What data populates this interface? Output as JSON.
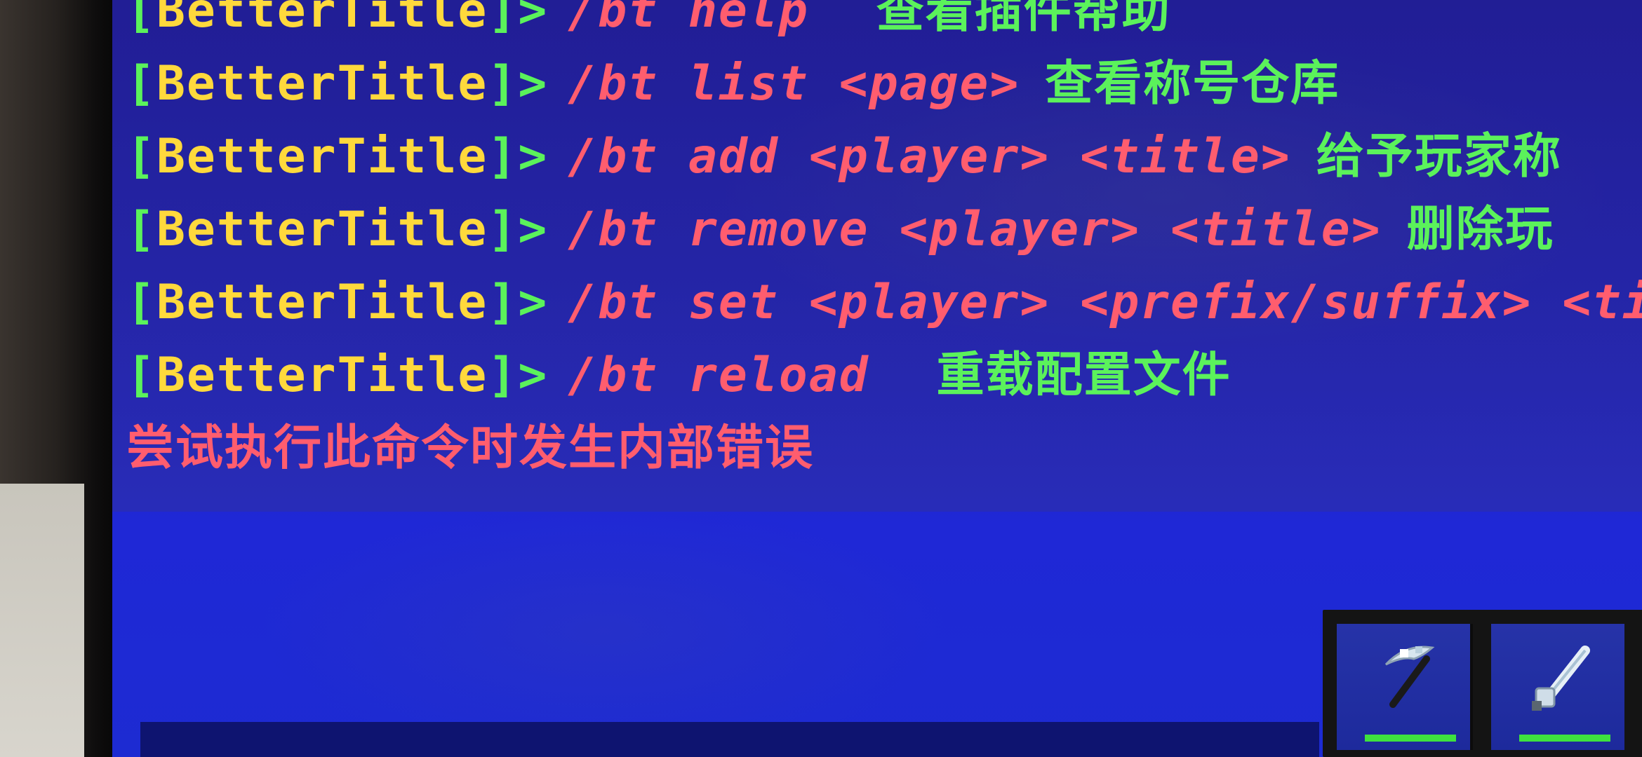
{
  "chat": {
    "partial_top_text": "查看插件帮助",
    "prefix_open": "[",
    "prefix_name": "BetterTitle",
    "prefix_close": "]",
    "arrow": ">",
    "lines": [
      {
        "command": "/bt help",
        "description": "查看插件帮助"
      },
      {
        "command": "/bt list <page>",
        "description": "查看称号仓库"
      },
      {
        "command": "/bt add <player> <title>",
        "description": "给予玩家称"
      },
      {
        "command": "/bt remove <player> <title>",
        "description": "删除玩"
      },
      {
        "command": "/bt set <player> <prefix/suffix> <ti",
        "description": ""
      },
      {
        "command": "/bt reload",
        "description": "重载配置文件"
      }
    ],
    "error": "尝试执行此命令时发生内部错误"
  },
  "hotbar": {
    "slots": [
      {
        "icon": "pickaxe-icon",
        "durability": 1.0
      },
      {
        "icon": "sword-icon",
        "durability": 1.0
      }
    ]
  },
  "colors": {
    "bracket": "#5bf25b",
    "prefix": "#ffd93c",
    "command": "#ff5d6e",
    "description": "#5bf25b",
    "error": "#ff5d6e",
    "screen_blue": "#1b1ec4"
  }
}
